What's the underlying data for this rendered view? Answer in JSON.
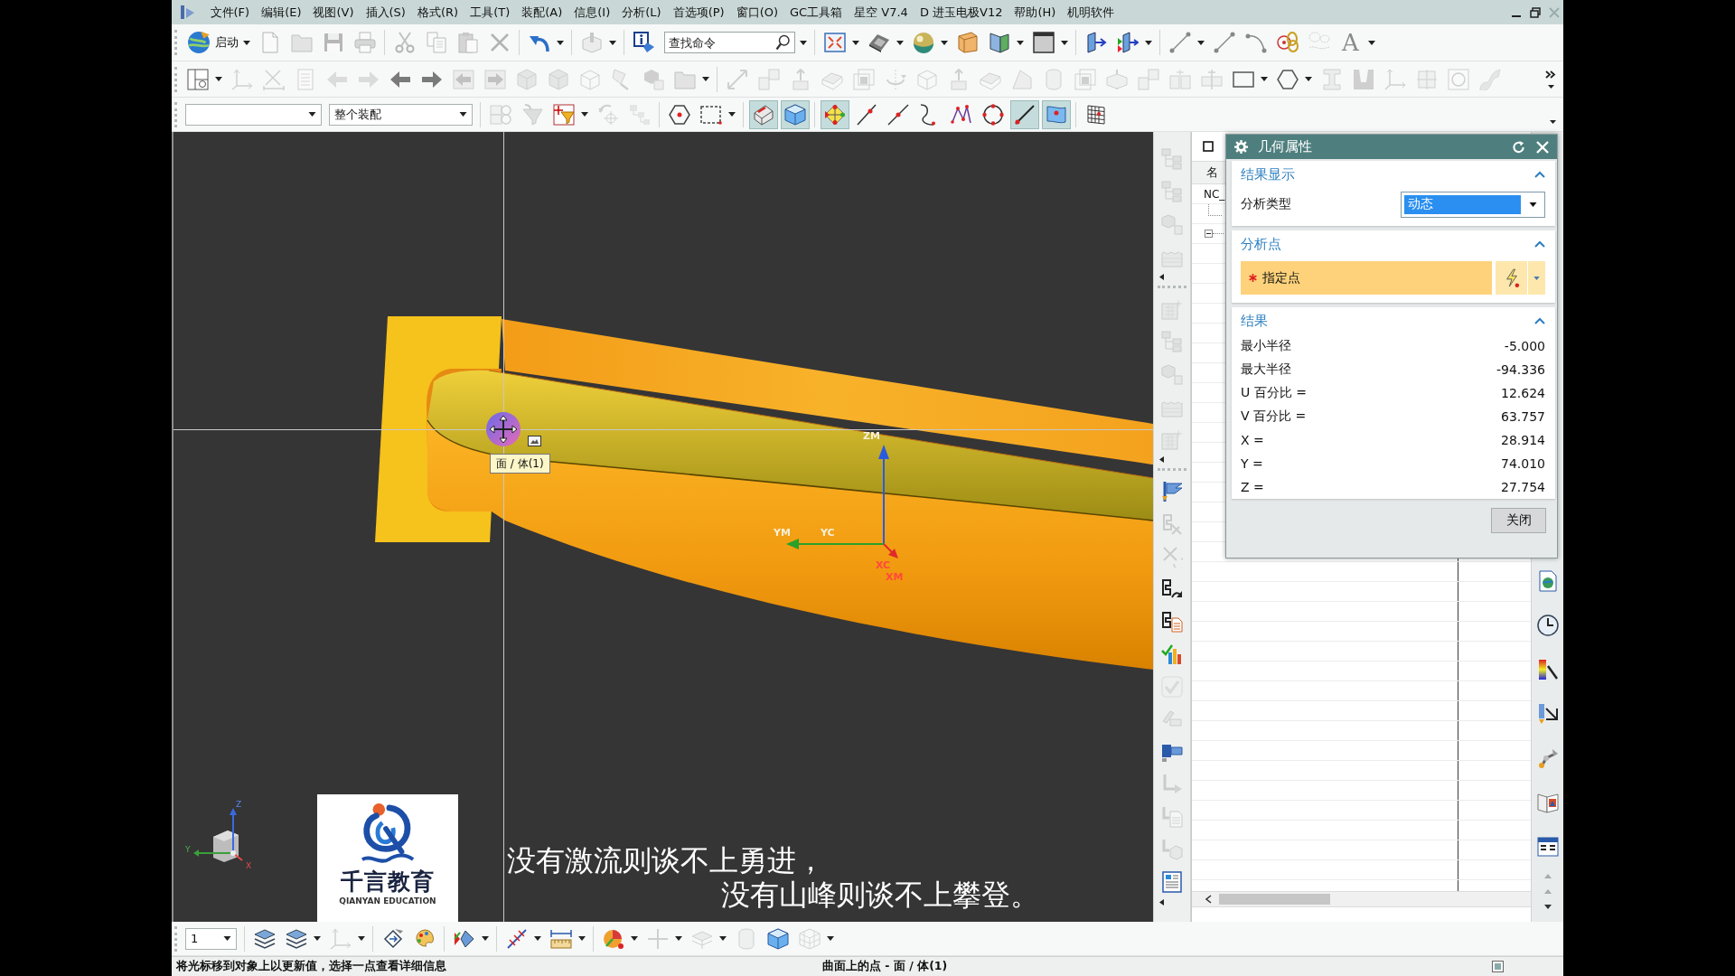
{
  "menu_bar": {
    "items": [
      "文件(F)",
      "编辑(E)",
      "视图(V)",
      "插入(S)",
      "格式(R)",
      "工具(T)",
      "装配(A)",
      "信息(I)",
      "分析(L)",
      "首选项(P)",
      "窗口(O)",
      "GC工具箱",
      "星空 V7.4",
      "D 进玉电极V12",
      "帮助(H)",
      "机明软件"
    ]
  },
  "toolbar_rows": [
    {
      "groups": [
        [
          {
            "kind": "start",
            "label": "启动",
            "disabled": false,
            "dropdown": true
          },
          {
            "kind": "tool",
            "disabled": true,
            "dropdown": false
          },
          {
            "kind": "tool",
            "disabled": true,
            "dropdown": false
          },
          {
            "kind": "tool",
            "disabled": true,
            "dropdown": false
          },
          {
            "kind": "tool",
            "disabled": true,
            "dropdown": false
          }
        ],
        [
          {
            "disabled": true,
            "dropdown": false
          },
          {
            "disabled": true,
            "dropdown": false
          },
          {
            "disabled": true,
            "dropdown": false
          },
          {
            "disabled": true,
            "dropdown": false
          }
        ],
        [
          {
            "disabled": false,
            "dropdown": true
          }
        ],
        [
          {
            "disabled": true,
            "dropdown": true
          }
        ],
        [
          {
            "kind": "tool",
            "disabled": false,
            "dropdown": false
          },
          {
            "kind": "search",
            "placeholder": "查找命令",
            "disabled": false,
            "dropdown": true
          }
        ],
        [
          {
            "disabled": false,
            "dropdown": true
          },
          {
            "disabled": false,
            "dropdown": true
          },
          {
            "disabled": false,
            "dropdown": true
          },
          {
            "disabled": false,
            "dropdown": false
          },
          {
            "disabled": false,
            "dropdown": true
          },
          {
            "disabled": false,
            "dropdown": true
          }
        ],
        [
          {
            "disabled": false,
            "dropdown": false
          },
          {
            "disabled": false,
            "dropdown": true
          }
        ],
        [
          {
            "kind": "tool",
            "disabled": false,
            "dropdown": true
          },
          {
            "kind": "tool",
            "disabled": false,
            "dropdown": false
          },
          {
            "kind": "tool",
            "disabled": false,
            "dropdown": false
          },
          {
            "kind": "tool",
            "disabled": false,
            "dropdown": false
          },
          {
            "kind": "tool",
            "disabled": true,
            "dropdown": false
          },
          {
            "kind": "glyph",
            "text": "A",
            "disabled": false,
            "dropdown": true
          }
        ]
      ]
    },
    {
      "groups": [
        [
          {
            "disabled": false,
            "dropdown": true
          },
          {
            "disabled": true,
            "dropdown": false
          },
          {
            "disabled": true,
            "dropdown": false
          },
          {
            "disabled": true,
            "dropdown": false
          },
          {
            "disabled": true,
            "dropdown": false
          },
          {
            "disabled": true,
            "dropdown": false
          },
          {
            "disabled": false,
            "dropdown": false
          },
          {
            "disabled": false,
            "dropdown": false
          },
          {
            "disabled": true,
            "dropdown": false
          },
          {
            "disabled": true,
            "dropdown": false
          },
          {
            "disabled": true,
            "dropdown": false
          },
          {
            "disabled": true,
            "dropdown": false
          },
          {
            "disabled": true,
            "dropdown": false
          },
          {
            "disabled": true,
            "dropdown": false
          },
          {
            "disabled": true,
            "dropdown": false
          },
          {
            "disabled": true,
            "dropdown": true
          }
        ],
        [
          {
            "disabled": true,
            "dropdown": false
          },
          {
            "disabled": true,
            "dropdown": false
          },
          {
            "disabled": true,
            "dropdown": false
          },
          {
            "disabled": true,
            "dropdown": false
          },
          {
            "disabled": true,
            "dropdown": false
          },
          {
            "disabled": true,
            "dropdown": false
          },
          {
            "disabled": true,
            "dropdown": false
          },
          {
            "disabled": true,
            "dropdown": false
          },
          {
            "disabled": true,
            "dropdown": false
          },
          {
            "disabled": true,
            "dropdown": false
          },
          {
            "disabled": true,
            "dropdown": false
          },
          {
            "disabled": true,
            "dropdown": false
          },
          {
            "disabled": true,
            "dropdown": false
          },
          {
            "disabled": true,
            "dropdown": false
          },
          {
            "disabled": true,
            "dropdown": false
          },
          {
            "disabled": true,
            "dropdown": false
          },
          {
            "disabled": false,
            "dropdown": true
          },
          {
            "disabled": false,
            "dropdown": true
          },
          {
            "disabled": true,
            "dropdown": false
          },
          {
            "disabled": true,
            "dropdown": false
          },
          {
            "disabled": true,
            "dropdown": false
          },
          {
            "disabled": true,
            "dropdown": false
          },
          {
            "disabled": true,
            "dropdown": false
          },
          {
            "disabled": true,
            "dropdown": false
          }
        ]
      ]
    },
    {
      "groups": [
        [
          {
            "kind": "select",
            "disabled": false,
            "dropdown": true
          },
          {
            "kind": "select",
            "value": "整个装配",
            "disabled": false,
            "dropdown": true
          }
        ],
        [
          {
            "disabled": true,
            "dropdown": false,
            "pressed": false
          },
          {
            "disabled": true,
            "dropdown": false,
            "pressed": false
          },
          {
            "disabled": false,
            "dropdown": true,
            "pressed": false
          },
          {
            "disabled": true,
            "dropdown": false,
            "pressed": false
          },
          {
            "disabled": true,
            "dropdown": false,
            "pressed": false
          }
        ],
        [
          {
            "disabled": false,
            "dropdown": false,
            "pressed": false
          },
          {
            "disabled": false,
            "dropdown": true,
            "pressed": false
          }
        ],
        [
          {
            "disabled": false,
            "dropdown": false,
            "pressed": true
          },
          {
            "disabled": false,
            "dropdown": false,
            "pressed": true
          }
        ],
        [
          {
            "disabled": false,
            "dropdown": false,
            "pressed": true
          },
          {
            "disabled": false,
            "dropdown": false,
            "pressed": false
          },
          {
            "disabled": false,
            "dropdown": false,
            "pressed": false
          },
          {
            "disabled": false,
            "dropdown": false,
            "pressed": false
          },
          {
            "disabled": false,
            "dropdown": false,
            "pressed": false
          },
          {
            "disabled": false,
            "dropdown": false,
            "pressed": false
          },
          {
            "disabled": false,
            "dropdown": false,
            "pressed": true
          },
          {
            "disabled": false,
            "dropdown": false,
            "pressed": true
          }
        ],
        [
          {
            "disabled": false,
            "dropdown": false,
            "pressed": false
          }
        ]
      ]
    }
  ],
  "viewport": {
    "wcs_labels": [
      "ZM",
      "YM",
      "YC",
      "XC",
      "XM"
    ],
    "tooltip": "面 / 体(1)",
    "view_triad_labels": [
      "Z",
      "Y",
      "X"
    ],
    "logo": {
      "name": "千言教育",
      "tagline": "QIANYAN EDUCATION"
    },
    "subtitles": [
      "没有激流则谈不上勇进，",
      "没有山峰则谈不上攀登。"
    ]
  },
  "side_toolbar": {
    "groups": [
      [
        {
          "disabled": true
        },
        {
          "disabled": true
        },
        {
          "disabled": true
        },
        {
          "disabled": true
        }
      ],
      [
        {
          "disabled": true
        },
        {
          "disabled": true
        },
        {
          "disabled": true
        },
        {
          "disabled": true
        },
        {
          "disabled": true
        }
      ],
      [
        {
          "disabled": false
        },
        {
          "disabled": true
        },
        {
          "disabled": true
        },
        {
          "disabled": false
        },
        {
          "disabled": false
        },
        {
          "disabled": false
        },
        {
          "disabled": true
        },
        {
          "disabled": true
        },
        {
          "disabled": false
        },
        {
          "disabled": true
        },
        {
          "disabled": true
        },
        {
          "disabled": true
        },
        {
          "disabled": false
        }
      ]
    ]
  },
  "navigator": {
    "header": "名",
    "root": "NC_"
  },
  "dialog": {
    "title": "几何属性",
    "sections": [
      {
        "title": "结果显示",
        "expanded": true,
        "rows": [
          {
            "kind": "select",
            "label": "分析类型",
            "value": "动态"
          }
        ]
      },
      {
        "title": "分析点",
        "expanded": true,
        "rows": [
          {
            "kind": "point",
            "label": "指定点",
            "required": true
          }
        ]
      },
      {
        "title": "结果",
        "expanded": true,
        "rows": [
          {
            "kind": "value",
            "label": "最小半径",
            "value": "-5.000"
          },
          {
            "kind": "value",
            "label": "最大半径",
            "value": "-94.336"
          },
          {
            "kind": "value",
            "label": "U 百分比 =",
            "value": "12.624"
          },
          {
            "kind": "value",
            "label": "V 百分比 =",
            "value": "63.757"
          },
          {
            "kind": "value",
            "label": "X =",
            "value": "28.914"
          },
          {
            "kind": "value",
            "label": "Y =",
            "value": "74.010"
          },
          {
            "kind": "value",
            "label": "Z =",
            "value": "27.754"
          }
        ]
      }
    ],
    "buttons": [
      "关闭"
    ]
  },
  "bottom_toolbar": {
    "groups": [
      [
        {
          "kind": "select",
          "value": "1",
          "disabled": false,
          "dropdown": true
        }
      ],
      [
        {
          "disabled": false,
          "dropdown": false
        },
        {
          "disabled": false,
          "dropdown": true
        },
        {
          "disabled": true,
          "dropdown": true
        }
      ],
      [
        {
          "disabled": false,
          "dropdown": false
        },
        {
          "disabled": false,
          "dropdown": false
        }
      ],
      [
        {
          "disabled": false,
          "dropdown": true
        }
      ],
      [
        {
          "disabled": false,
          "dropdown": true
        },
        {
          "disabled": false,
          "dropdown": true
        }
      ],
      [
        {
          "disabled": false,
          "dropdown": true
        },
        {
          "disabled": true,
          "dropdown": true
        },
        {
          "disabled": true,
          "dropdown": true
        },
        {
          "disabled": true,
          "dropdown": false
        },
        {
          "disabled": false,
          "dropdown": false
        },
        {
          "disabled": true,
          "dropdown": true
        }
      ]
    ]
  },
  "status_bar": {
    "message": "将光标移到对象上以更新值，选择一点查看详细信息",
    "selection": "曲面上的点 - 面 / 体(1)"
  }
}
